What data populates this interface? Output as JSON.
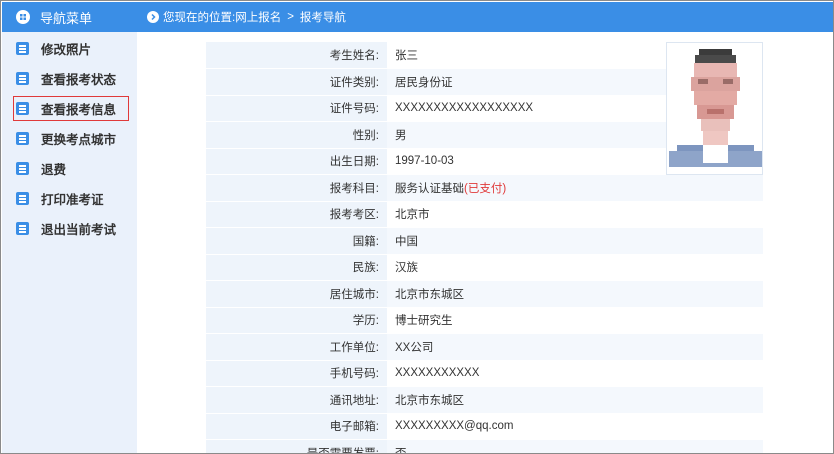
{
  "sidebar": {
    "header": "导航菜单",
    "items": [
      {
        "label": "修改照片",
        "active": false
      },
      {
        "label": "查看报考状态",
        "active": false
      },
      {
        "label": "查看报考信息",
        "active": true
      },
      {
        "label": "更换考点城市",
        "active": false
      },
      {
        "label": "退费",
        "active": false
      },
      {
        "label": "打印准考证",
        "active": false
      },
      {
        "label": "退出当前考试",
        "active": false
      }
    ]
  },
  "breadcrumb": {
    "prefix": "您现在的位置:",
    "path": [
      "网上报名",
      "报考导航"
    ],
    "separator": ">"
  },
  "profile": {
    "rows": [
      {
        "label": "考生姓名:",
        "value": "张三"
      },
      {
        "label": "证件类别:",
        "value": "居民身份证"
      },
      {
        "label": "证件号码:",
        "value": "XXXXXXXXXXXXXXXXXX"
      },
      {
        "label": "性别:",
        "value": "男"
      },
      {
        "label": "出生日期:",
        "value": "1997-10-03"
      },
      {
        "label": "报考科目:",
        "value": "服务认证基础",
        "status": "(已支付)"
      },
      {
        "label": "报考考区:",
        "value": "北京市"
      },
      {
        "label": "国籍:",
        "value": "中国"
      },
      {
        "label": "民族:",
        "value": "汉族"
      },
      {
        "label": "居住城市:",
        "value": "北京市东城区"
      },
      {
        "label": "学历:",
        "value": "博士研究生"
      },
      {
        "label": "工作单位:",
        "value": "XX公司"
      },
      {
        "label": "手机号码:",
        "value": "XXXXXXXXXXX"
      },
      {
        "label": "通讯地址:",
        "value": "北京市东城区"
      },
      {
        "label": "电子邮箱:",
        "value": "XXXXXXXXX@qq.com"
      },
      {
        "label": "是否需要发票:",
        "value": "否"
      }
    ]
  },
  "colors": {
    "accent": "#3a8ee6",
    "sidebar_bg": "#eaf1fb",
    "label_bg": "#eef4fb",
    "highlight": "#e03a3a"
  },
  "icons": {
    "header_icon": "menu-circle-icon",
    "breadcrumb_icon": "chevron-right-circle-icon",
    "item_icon": "list-icon"
  }
}
